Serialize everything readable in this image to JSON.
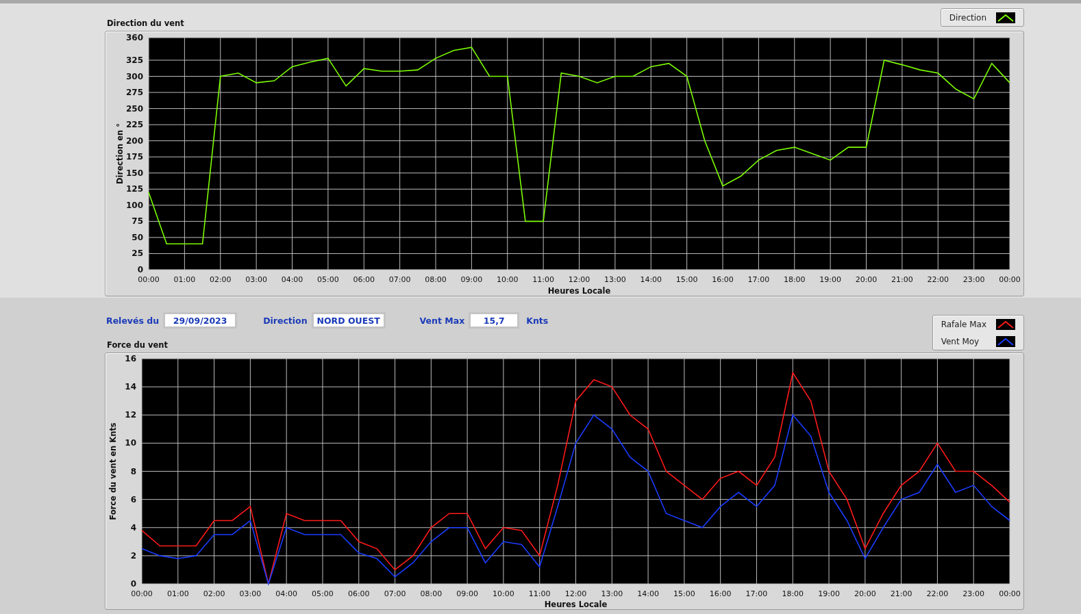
{
  "direction_panel": {
    "title": "Direction du vent",
    "chart_data": {
      "type": "line",
      "grid": true,
      "xlabel": "Heures Locale",
      "ylabel": "Direction en °",
      "ylim": [
        0,
        360
      ],
      "xlim": [
        0,
        24
      ],
      "yticks": [
        0,
        25,
        50,
        75,
        100,
        125,
        150,
        175,
        200,
        225,
        250,
        275,
        300,
        325,
        360
      ],
      "xticks": [
        {
          "value": 0,
          "label": "00:00"
        },
        {
          "value": 1,
          "label": "01:00"
        },
        {
          "value": 2,
          "label": "02:00"
        },
        {
          "value": 3,
          "label": "03:00"
        },
        {
          "value": 4,
          "label": "04:00"
        },
        {
          "value": 5,
          "label": "05:00"
        },
        {
          "value": 6,
          "label": "06:00"
        },
        {
          "value": 7,
          "label": "07:00"
        },
        {
          "value": 8,
          "label": "08:00"
        },
        {
          "value": 9,
          "label": "09:00"
        },
        {
          "value": 10,
          "label": "10:00"
        },
        {
          "value": 11,
          "label": "11:00"
        },
        {
          "value": 12,
          "label": "12:00"
        },
        {
          "value": 13,
          "label": "13:00"
        },
        {
          "value": 14,
          "label": "14:00"
        },
        {
          "value": 15,
          "label": "15:00"
        },
        {
          "value": 16,
          "label": "16:00"
        },
        {
          "value": 17,
          "label": "17:00"
        },
        {
          "value": 18,
          "label": "18:00"
        },
        {
          "value": 19,
          "label": "19:00"
        },
        {
          "value": 20,
          "label": "20:00"
        },
        {
          "value": 21,
          "label": "21:00"
        },
        {
          "value": 22,
          "label": "22:00"
        },
        {
          "value": 23,
          "label": "23:00"
        },
        {
          "value": 24,
          "label": "00:00"
        }
      ],
      "x": [
        0,
        0.5,
        1,
        1.5,
        2,
        2.5,
        3,
        3.5,
        4,
        4.5,
        5,
        5.5,
        6,
        6.5,
        7,
        7.5,
        8,
        8.5,
        9,
        9.5,
        10,
        10.5,
        11,
        11.5,
        12,
        12.5,
        13,
        13.5,
        14,
        14.5,
        15,
        15.5,
        16,
        16.5,
        17,
        17.5,
        18,
        18.5,
        19,
        19.5,
        20,
        20.5,
        21,
        21.5,
        22,
        22.5,
        23,
        23.5,
        24
      ],
      "series": [
        {
          "name": "Direction",
          "color": "#7cfc00",
          "values": [
            120,
            40,
            40,
            40,
            300,
            305,
            290,
            293,
            315,
            322,
            328,
            285,
            312,
            308,
            308,
            310,
            328,
            340,
            345,
            300,
            300,
            75,
            75,
            305,
            300,
            290,
            300,
            300,
            315,
            320,
            300,
            200,
            130,
            145,
            170,
            185,
            190,
            180,
            170,
            190,
            190,
            325,
            318,
            310,
            305,
            280,
            265,
            320,
            290
          ]
        }
      ]
    }
  },
  "readings": {
    "date_label": "Relevés du",
    "date": "29/09/2023",
    "direction_label": "Direction",
    "direction": "NORD OUEST",
    "max_label": "Vent Max",
    "max": "15,7",
    "unit": "Knts"
  },
  "force_panel": {
    "title": "Force du vent",
    "chart_data": {
      "type": "line",
      "grid": true,
      "xlabel": "Heures Locale",
      "ylabel": "Force du vent en Knts",
      "ylim": [
        0,
        16
      ],
      "xlim": [
        0,
        24
      ],
      "yticks": [
        0,
        2,
        4,
        6,
        8,
        10,
        12,
        14,
        16
      ],
      "xticks": [
        {
          "value": 0,
          "label": "00:00"
        },
        {
          "value": 1,
          "label": "01:00"
        },
        {
          "value": 2,
          "label": "02:00"
        },
        {
          "value": 3,
          "label": "03:00"
        },
        {
          "value": 4,
          "label": "04:00"
        },
        {
          "value": 5,
          "label": "05:00"
        },
        {
          "value": 6,
          "label": "06:00"
        },
        {
          "value": 7,
          "label": "07:00"
        },
        {
          "value": 8,
          "label": "08:00"
        },
        {
          "value": 9,
          "label": "09:00"
        },
        {
          "value": 10,
          "label": "10:00"
        },
        {
          "value": 11,
          "label": "11:00"
        },
        {
          "value": 12,
          "label": "12:00"
        },
        {
          "value": 13,
          "label": "13:00"
        },
        {
          "value": 14,
          "label": "14:00"
        },
        {
          "value": 15,
          "label": "15:00"
        },
        {
          "value": 16,
          "label": "16:00"
        },
        {
          "value": 17,
          "label": "17:00"
        },
        {
          "value": 18,
          "label": "18:00"
        },
        {
          "value": 19,
          "label": "19:00"
        },
        {
          "value": 20,
          "label": "20:00"
        },
        {
          "value": 21,
          "label": "21:00"
        },
        {
          "value": 22,
          "label": "22:00"
        },
        {
          "value": 23,
          "label": "23:00"
        },
        {
          "value": 24,
          "label": "00:00"
        }
      ],
      "x": [
        0,
        0.5,
        1,
        1.5,
        2,
        2.5,
        3,
        3.5,
        4,
        4.5,
        5,
        5.5,
        6,
        6.5,
        7,
        7.5,
        8,
        8.5,
        9,
        9.5,
        10,
        10.5,
        11,
        11.5,
        12,
        12.5,
        13,
        13.5,
        14,
        14.5,
        15,
        15.5,
        16,
        16.5,
        17,
        17.5,
        18,
        18.5,
        19,
        19.5,
        20,
        20.5,
        21,
        21.5,
        22,
        22.5,
        23,
        23.5,
        24
      ],
      "series": [
        {
          "name": "Rafale Max",
          "color": "#ff1a1a",
          "values": [
            3.8,
            2.7,
            2.7,
            2.7,
            4.5,
            4.5,
            5.5,
            0,
            5,
            4.5,
            4.5,
            4.5,
            3,
            2.5,
            1,
            2,
            4,
            5,
            5,
            2.5,
            4,
            3.8,
            2,
            7,
            13,
            14.5,
            14,
            12,
            11,
            8,
            7,
            6,
            7.5,
            8,
            7,
            9,
            15,
            13,
            8,
            6,
            2.5,
            5,
            7,
            8,
            10,
            8,
            8,
            7,
            5.8
          ]
        },
        {
          "name": "Vent Moy",
          "color": "#1a3cff",
          "values": [
            2.5,
            2,
            1.8,
            2,
            3.5,
            3.5,
            4.5,
            0,
            4,
            3.5,
            3.5,
            3.5,
            2.2,
            1.8,
            0.5,
            1.5,
            3,
            4,
            4,
            1.5,
            3,
            2.8,
            1.2,
            5.5,
            10,
            12,
            11,
            9,
            8,
            5,
            4.5,
            4,
            5.5,
            6.5,
            5.5,
            7,
            12,
            10.5,
            6.5,
            4.5,
            1.8,
            4,
            6,
            6.5,
            8.5,
            6.5,
            7,
            5.5,
            4.5
          ]
        }
      ]
    }
  }
}
